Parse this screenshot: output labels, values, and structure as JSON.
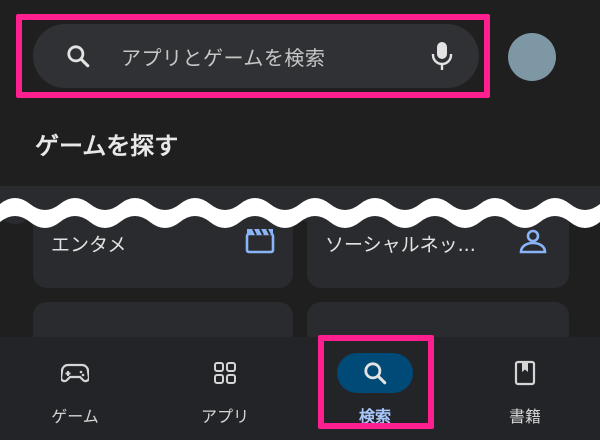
{
  "search": {
    "placeholder": "アプリとゲームを検索",
    "search_icon": "search-icon",
    "mic_icon": "microphone-icon"
  },
  "profile": {
    "avatar_color": "#7e97a5"
  },
  "section": {
    "title": "ゲームを探す"
  },
  "categories": [
    {
      "label": "エンタメ",
      "icon": "clapperboard-icon"
    },
    {
      "label": "ソーシャルネッ...",
      "icon": "people-icon"
    },
    {
      "label": "",
      "icon": "category-icon"
    },
    {
      "label": "",
      "icon": "category-icon"
    }
  ],
  "bottom_nav": {
    "items": [
      {
        "label": "ゲーム",
        "icon": "gamepad-icon",
        "active": false
      },
      {
        "label": "アプリ",
        "icon": "apps-grid-icon",
        "active": false
      },
      {
        "label": "検索",
        "icon": "search-icon",
        "active": true
      },
      {
        "label": "書籍",
        "icon": "book-icon",
        "active": false
      }
    ]
  },
  "colors": {
    "background": "#1f1f1f",
    "highlight": "#ff1f8e",
    "active_pill": "#004a77",
    "active_label": "#a8c7fa",
    "category_icon": "#8ab4f8"
  }
}
